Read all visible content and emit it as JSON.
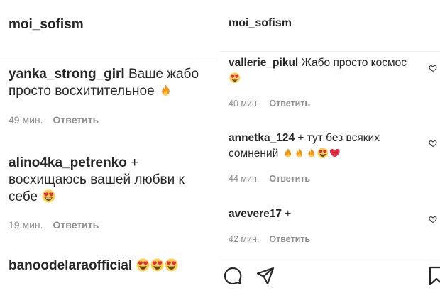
{
  "left": {
    "header": "moi_sofism",
    "comments": [
      {
        "user": "yanka_strong_girl",
        "text": " Ваше жабо просто восхитительное ",
        "emoji": [
          "fire"
        ],
        "time": "49 мин.",
        "reply": "Ответить"
      },
      {
        "user": "alino4ka_petrenko",
        "text": " + восхищаюсь вашей любви к себе ",
        "emoji": [
          "heart-eyes"
        ],
        "time": "19 мин.",
        "reply": "Ответить"
      },
      {
        "user": "banoodelaraofficial",
        "text": " ",
        "emoji": [
          "heart-eyes",
          "heart-eyes",
          "heart-eyes"
        ]
      }
    ]
  },
  "right": {
    "header": "moi_sofism",
    "comments": [
      {
        "user": "vallerie_pikul",
        "text": " Жабо просто космос",
        "emoji": [
          "heart-eyes"
        ],
        "time": "40 мин.",
        "reply": "Ответить",
        "like_icon": "heart-outline-icon"
      },
      {
        "user": "annetka_124",
        "text": " + тут без всяких сомнений ",
        "emoji": [
          "fire",
          "fire",
          "fire",
          "heart-eyes",
          "red-heart"
        ],
        "time": "44 мин.",
        "reply": "Ответить",
        "like_icon": "heart-outline-icon"
      },
      {
        "user": "avevere17",
        "text": " +",
        "emoji": [],
        "time": "42 мин.",
        "reply": "Ответить",
        "like_icon": "heart-outline-icon"
      }
    ],
    "actions": [
      "comment-icon",
      "share-icon",
      "save-icon"
    ]
  },
  "colors": {
    "text": "#262626",
    "meta": "#8e8e8e",
    "divider": "#efefef",
    "fire": "#f4900c",
    "heart": "#dd2e44",
    "face": "#ffcc4d"
  }
}
